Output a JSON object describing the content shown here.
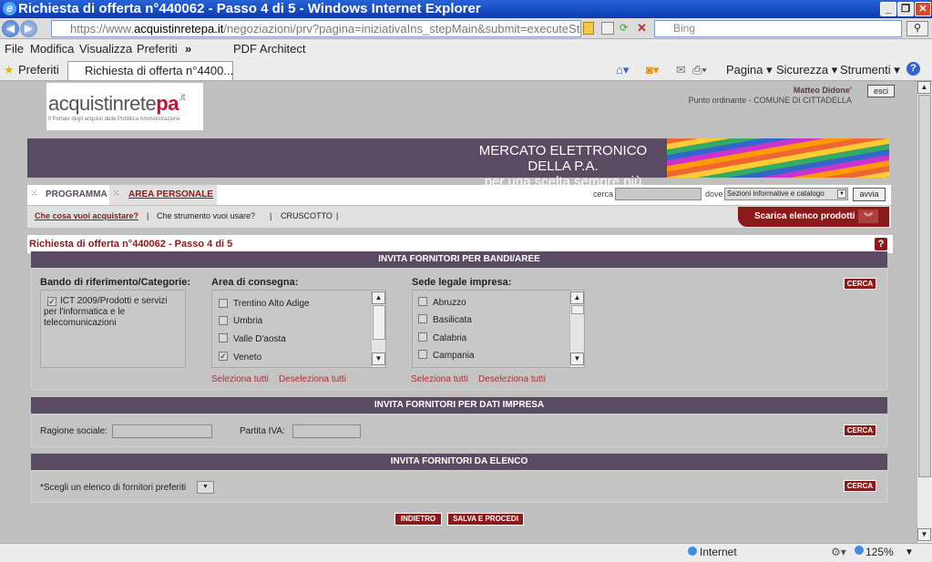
{
  "window": {
    "title": "Richiesta di offerta n°440062 - Passo 4 di 5 - Windows Internet Explorer",
    "min": "_",
    "max": "❐",
    "close": "✕"
  },
  "address": {
    "url_prefix": "https://www.",
    "url_domain": "acquistinretepa.it",
    "url_rest": "/negoziazioni/prv?pagina=iniziativaIns_stepMain&submit=executeStep",
    "search_placeholder": "Bing"
  },
  "menu": {
    "items": [
      "File",
      "Modifica",
      "Visualizza",
      "Preferiti",
      "»",
      "PDF Architect"
    ]
  },
  "favbar": {
    "favorites": "Preferiti",
    "tab": "Richiesta di offerta n°4400...",
    "cmds": [
      "Pagina ▾",
      "Sicurezza ▾",
      "Strumenti ▾"
    ]
  },
  "page": {
    "logo_main": "acquistinrete",
    "logo_pa": "pa",
    "logo_it": ".it",
    "logo_tagline": "Il Portale degli acquisti della Pubblica Amministrazione",
    "user_name": "Matteo Didone'",
    "user_point": "Punto ordinante - COMUNE DI CITTADELLA",
    "logout": "esci",
    "banner_l1": "MERCATO ELETTRONICO DELLA P.A.",
    "banner_l2": "per una scelta sempre più ampia!",
    "nav_programma": "PROGRAMMA",
    "nav_area": "AREA PERSONALE",
    "search_label": "cerca",
    "dove_label": "dove",
    "dove_value": "Sezioni informative e catalogo",
    "avvia": "avvia",
    "subnav": [
      "Che cosa vuoi acquistare?",
      "|",
      "Che strumento vuoi usare?",
      "|",
      "CRUSCOTTO",
      "|"
    ],
    "scarica": "Scarica elenco prodotti",
    "page_title": "Richiesta di offerta n°440062 - Passo 4 di 5",
    "help": "?",
    "sec1": "INVITA FORNITORI PER BANDI/AREE",
    "bando_label": "Bando di riferimento/Categorie:",
    "bando_item": "ICT 2009/Prodotti e servizi per l'informatica e le telecomunicazioni",
    "area_label": "Area di consegna:",
    "area_items": [
      "Trentino Alto Adige",
      "Umbria",
      "Valle D'aosta",
      "Veneto"
    ],
    "area_checked": [
      "",
      "",
      "",
      "✓"
    ],
    "sede_label": "Sede legale impresa:",
    "sede_items": [
      "Abruzzo",
      "Basilicata",
      "Calabria",
      "Campania"
    ],
    "sel_all": "Seleziona tutti",
    "desel_all": "Deseleziona tutti",
    "cerca": "CERCA",
    "sec2": "INVITA FORNITORI PER DATI IMPRESA",
    "ragione": "Ragione sociale:",
    "piva": "Partita IVA:",
    "sec3": "INVITA FORNITORI DA ELENCO",
    "elenco_label": "*Scegli un elenco di fornitori preferiti",
    "indietro": "INDIETRO",
    "salva": "SALVA E PROCEDI"
  },
  "status": {
    "zone": "Internet",
    "zoom": "125%"
  }
}
